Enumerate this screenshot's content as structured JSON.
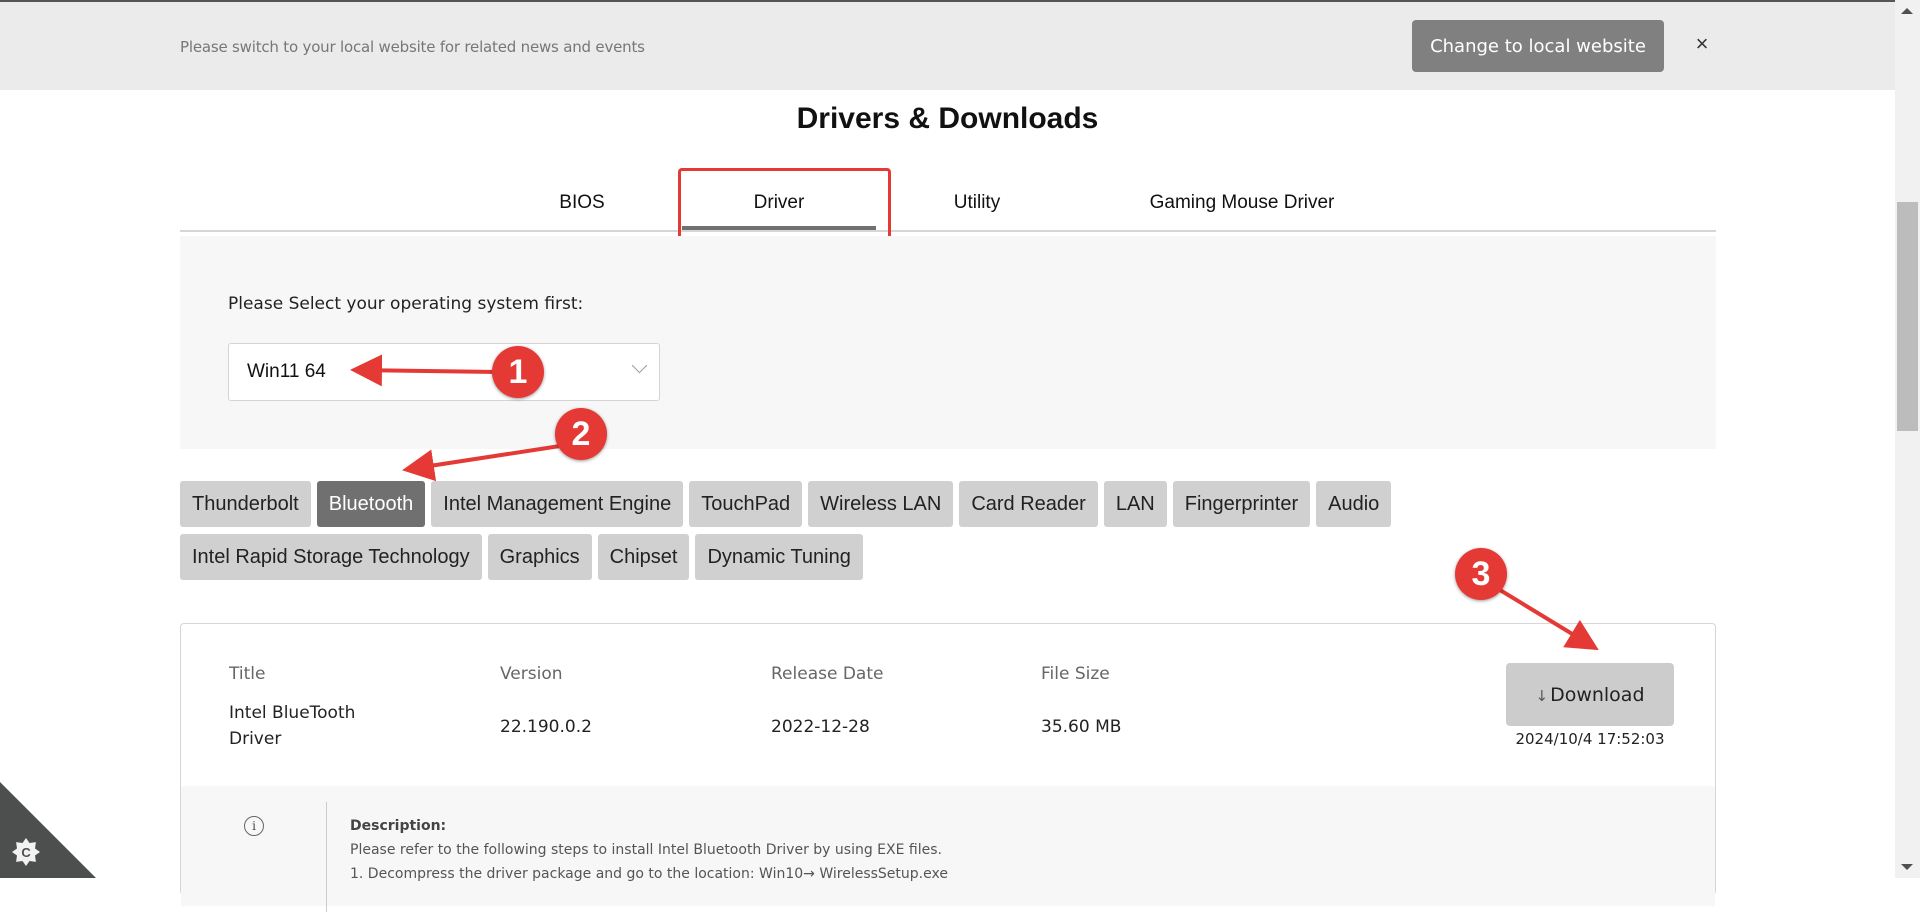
{
  "banner": {
    "message": "Please switch to your local website for related news and events",
    "button_label": "Change to local website",
    "close_icon": "×"
  },
  "page": {
    "title": "Drivers & Downloads"
  },
  "tabs": [
    {
      "label": "BIOS",
      "active": false
    },
    {
      "label": "Driver",
      "active": true
    },
    {
      "label": "Utility",
      "active": false
    },
    {
      "label": "Gaming Mouse Driver",
      "active": false
    }
  ],
  "os_selector": {
    "label": "Please Select your operating system first:",
    "selected": "Win11 64"
  },
  "categories": {
    "row1": [
      "Thunderbolt",
      "Bluetooth",
      "Intel Management Engine",
      "TouchPad",
      "Wireless LAN",
      "Card Reader",
      "LAN",
      "Fingerprinter",
      "Audio"
    ],
    "row2": [
      "Intel Rapid Storage Technology",
      "Graphics",
      "Chipset",
      "Dynamic Tuning"
    ],
    "active": "Bluetooth"
  },
  "driver_card": {
    "headers": {
      "title": "Title",
      "version": "Version",
      "release_date": "Release Date",
      "file_size": "File Size"
    },
    "title_line1": "Intel BlueTooth",
    "title_line2": "Driver",
    "version": "22.190.0.2",
    "release_date": "2022-12-28",
    "file_size": "35.60 MB",
    "download_icon": "↓",
    "download_label": "Download",
    "download_timestamp": "2024/10/4 17:52:03",
    "description": {
      "heading": "Description:",
      "line1": "Please refer to the following steps to install Intel Bluetooth Driver by using EXE files.",
      "line2": "1. Decompress the driver package and go to the location: Win10→ WirelessSetup.exe"
    }
  },
  "annotations": {
    "markers": [
      "1",
      "2",
      "3"
    ],
    "color": "#e53935"
  },
  "colors": {
    "banner_bg": "#ebebeb",
    "active_chip": "#707070",
    "chip": "#d0d0d0",
    "panel_bg": "#f7f7f7"
  }
}
